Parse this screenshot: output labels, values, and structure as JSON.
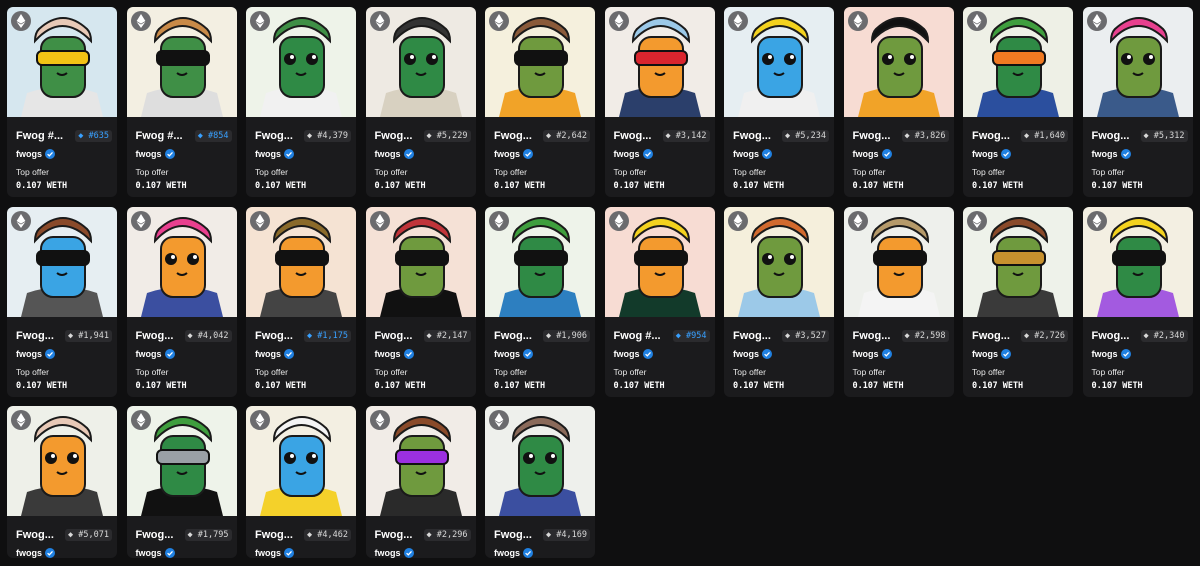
{
  "collection_name": "fwogs",
  "offer_label": "Top offer",
  "offer_value": "0.107 WETH",
  "chain_icon": "ethereum-icon",
  "colors": {
    "page_bg": "#0f0f10",
    "card_bg": "#1b1b1d",
    "rank_blue": "#38a0ff",
    "verified_blue": "#2081e2"
  },
  "items": [
    {
      "name": "Fwog #...",
      "rank": "◆ #635",
      "blue": true,
      "bg": "#d6e7ef",
      "body": "#3f8f46",
      "shirt": "#e6e6e6",
      "hat": "#e8c9b7",
      "glasses": "#f3c315",
      "has_offer": true
    },
    {
      "name": "Fwog #...",
      "rank": "◆ #854",
      "blue": true,
      "bg": "#f3efe2",
      "body": "#3f8f46",
      "shirt": "#dedede",
      "hat": "#c98a48",
      "glasses": "#111111",
      "has_offer": true
    },
    {
      "name": "Fwog...",
      "rank": "◆ #4,379",
      "blue": false,
      "bg": "#eef3e9",
      "body": "#2f8a45",
      "shirt": "#f1f1f1",
      "hat": "#3f8f46",
      "glasses": "",
      "has_offer": true
    },
    {
      "name": "Fwog...",
      "rank": "◆ #5,229",
      "blue": false,
      "bg": "#eeeae3",
      "body": "#2f8a45",
      "shirt": "#d8d1c1",
      "hat": "#333333",
      "glasses": "",
      "has_offer": true
    },
    {
      "name": "Fwog...",
      "rank": "◆ #2,642",
      "blue": false,
      "bg": "#f5f0dd",
      "body": "#6f9a3e",
      "shirt": "#f1a328",
      "hat": "#8a5a3a",
      "glasses": "#111111",
      "has_offer": true
    },
    {
      "name": "Fwog...",
      "rank": "◆ #3,142",
      "blue": false,
      "bg": "#f1ece7",
      "body": "#f39a2e",
      "shirt": "#2b3f6b",
      "hat": "#9cc9e8",
      "glasses": "#d9252e",
      "has_offer": true
    },
    {
      "name": "Fwog...",
      "rank": "◆ #5,234",
      "blue": false,
      "bg": "#e6eef2",
      "body": "#3aa4e4",
      "shirt": "#f0f0f0",
      "hat": "#f3d21f",
      "glasses": "",
      "has_offer": true
    },
    {
      "name": "Fwog...",
      "rank": "◆ #3,826",
      "blue": false,
      "bg": "#f7dcd3",
      "body": "#6f9a3e",
      "shirt": "#f1a328",
      "hat": "#111111",
      "glasses": "",
      "has_offer": true
    },
    {
      "name": "Fwog...",
      "rank": "◆ #1,640",
      "blue": false,
      "bg": "#eef0e6",
      "body": "#2f8a45",
      "shirt": "#2b4f9e",
      "hat": "#3f9e3e",
      "glasses": "#f07a22",
      "has_offer": true
    },
    {
      "name": "Fwog...",
      "rank": "◆ #5,312",
      "blue": false,
      "bg": "#ebeef0",
      "body": "#6f9a3e",
      "shirt": "#3a5a8a",
      "hat": "#e8408f",
      "glasses": "",
      "has_offer": true
    },
    {
      "name": "Fwog...",
      "rank": "◆ #1,941",
      "blue": false,
      "bg": "#e6eef2",
      "body": "#3aa4e4",
      "shirt": "#555555",
      "hat": "#8a4a2a",
      "glasses": "#111111",
      "has_offer": true
    },
    {
      "name": "Fwog...",
      "rank": "◆ #4,042",
      "blue": false,
      "bg": "#f1ece7",
      "body": "#f39a2e",
      "shirt": "#3b4fa0",
      "hat": "#e8408f",
      "glasses": "",
      "has_offer": true
    },
    {
      "name": "Fwog...",
      "rank": "◆ #1,175",
      "blue": true,
      "bg": "#f5e3d3",
      "body": "#f39a2e",
      "shirt": "#444444",
      "hat": "#8a6a2a",
      "glasses": "#111111",
      "has_offer": true
    },
    {
      "name": "Fwog...",
      "rank": "◆ #2,147",
      "blue": false,
      "bg": "#f5e1d6",
      "body": "#6f9a3e",
      "shirt": "#111111",
      "hat": "#c0343a",
      "glasses": "#111111",
      "has_offer": true
    },
    {
      "name": "Fwog...",
      "rank": "◆ #1,906",
      "blue": false,
      "bg": "#eef3ea",
      "body": "#2f8a45",
      "shirt": "#2d7fc0",
      "hat": "#3f9e3e",
      "glasses": "#111111",
      "has_offer": true
    },
    {
      "name": "Fwog #...",
      "rank": "◆ #954",
      "blue": true,
      "bg": "#f7dcd3",
      "body": "#f39a2e",
      "shirt": "#123a2a",
      "hat": "#f3d21f",
      "glasses": "#111111",
      "has_offer": true
    },
    {
      "name": "Fwog...",
      "rank": "◆ #3,527",
      "blue": false,
      "bg": "#f5efdc",
      "body": "#6f9a3e",
      "shirt": "#9cc9e8",
      "hat": "#d26a2e",
      "glasses": "",
      "has_offer": true
    },
    {
      "name": "Fwog...",
      "rank": "◆ #2,598",
      "blue": false,
      "bg": "#eef0ec",
      "body": "#f39a2e",
      "shirt": "#f4f4f4",
      "hat": "#b59a6a",
      "glasses": "#111111",
      "has_offer": true
    },
    {
      "name": "Fwog...",
      "rank": "◆ #2,726",
      "blue": false,
      "bg": "#eef2ea",
      "body": "#6f9a3e",
      "shirt": "#3a3a3a",
      "hat": "#8a4a2a",
      "glasses": "#c7912e",
      "has_offer": true
    },
    {
      "name": "Fwog...",
      "rank": "◆ #2,340",
      "blue": false,
      "bg": "#f3efe2",
      "body": "#2f8a45",
      "shirt": "#a35ae0",
      "hat": "#f3d21f",
      "glasses": "#111111",
      "has_offer": true
    },
    {
      "name": "Fwog...",
      "rank": "◆ #5,071",
      "blue": false,
      "bg": "#eef0e9",
      "body": "#f39a2e",
      "shirt": "#3a3a3a",
      "hat": "#e8c9b7",
      "glasses": "",
      "has_offer": false
    },
    {
      "name": "Fwog...",
      "rank": "◆ #1,795",
      "blue": false,
      "bg": "#eef3ea",
      "body": "#2f8a45",
      "shirt": "#111111",
      "hat": "#3f9e3e",
      "glasses": "#9aa0a6",
      "has_offer": false
    },
    {
      "name": "Fwog...",
      "rank": "◆ #4,462",
      "blue": false,
      "bg": "#f3efe2",
      "body": "#3aa4e4",
      "shirt": "#f4d12a",
      "hat": "#f4f4f4",
      "glasses": "",
      "has_offer": false
    },
    {
      "name": "Fwog...",
      "rank": "◆ #2,296",
      "blue": false,
      "bg": "#f1ece7",
      "body": "#6f9a3e",
      "shirt": "#2a2a2a",
      "hat": "#8a4a2a",
      "glasses": "#9b30e0",
      "has_offer": false
    },
    {
      "name": "Fwog...",
      "rank": "◆ #4,169",
      "blue": false,
      "bg": "#eef0ec",
      "body": "#2f8a45",
      "shirt": "#3b4fa0",
      "hat": "#8a6a5a",
      "glasses": "",
      "has_offer": false
    }
  ]
}
